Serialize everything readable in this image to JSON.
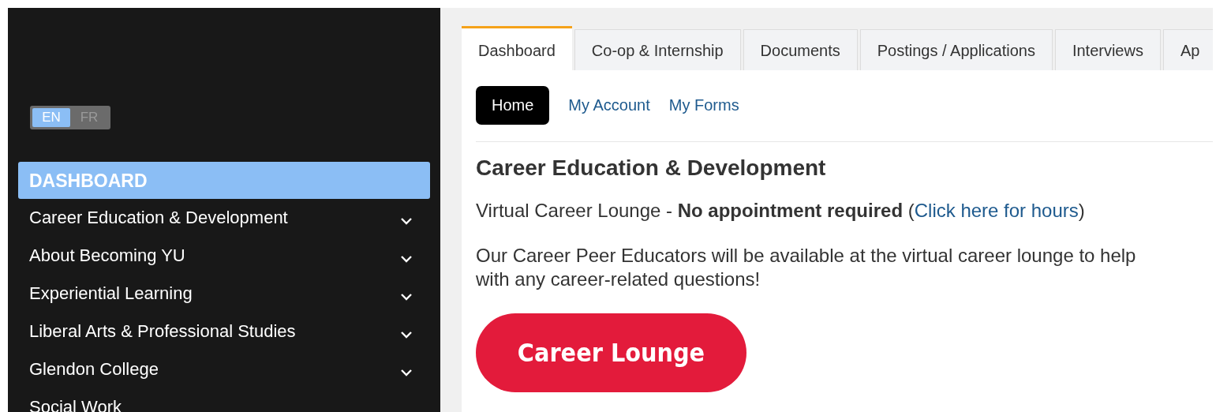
{
  "sidebar": {
    "language_toggle": [
      {
        "label": "EN",
        "selected": true
      },
      {
        "label": "FR",
        "selected": false
      }
    ],
    "section_header": "DASHBOARD",
    "items": [
      {
        "label": "Career Education & Development",
        "expanded": false
      },
      {
        "label": "About Becoming YU",
        "expanded": false
      },
      {
        "label": "Experiential Learning",
        "expanded": false
      },
      {
        "label": "Liberal Arts & Professional Studies",
        "expanded": false
      },
      {
        "label": "Glendon College",
        "expanded": false
      },
      {
        "label": "Social Work"
      }
    ]
  },
  "tabs": [
    {
      "label": "Dashboard",
      "selected": true
    },
    {
      "label": "Co-op & Internship",
      "selected": false
    },
    {
      "label": "Documents",
      "selected": false
    },
    {
      "label": "Postings / Applications",
      "selected": false
    },
    {
      "label": "Interviews",
      "selected": false
    },
    {
      "label": "Ap",
      "selected": false
    }
  ],
  "subnav": [
    {
      "label": "Home",
      "selected": true
    },
    {
      "label": "My Account",
      "selected": false
    },
    {
      "label": "My Forms",
      "selected": false
    }
  ],
  "content": {
    "heading": "Career Education & Development",
    "notice": {
      "text": "Virtual Career Lounge - **No appointment required** (",
      "link": "Click here for hours",
      "after": ")"
    },
    "paragraph": "Our Career Peer Educators will be available at the virtual career lounge to help with any career-related questions!",
    "button": "Career Lounge"
  }
}
